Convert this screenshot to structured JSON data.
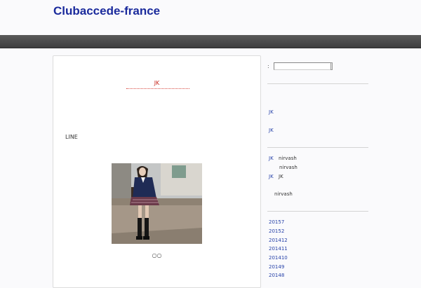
{
  "site": {
    "title": "Clubaccede-france"
  },
  "post": {
    "title": "JK",
    "text": "LINE",
    "caption": "○○",
    "image_alt": "Student in school uniform standing by a stone wall"
  },
  "search": {
    "label": ":"
  },
  "sidebar": {
    "recent_posts": [
      "JK",
      "JK"
    ],
    "comments": [
      {
        "link": "JK",
        "author": "nirvash"
      },
      {
        "link": "",
        "author": "nirvash"
      },
      {
        "link": "JK",
        "author": "JK"
      },
      {
        "link": "",
        "author": "nirvash"
      }
    ],
    "archives": [
      "20157",
      "20152",
      "201412",
      "201411",
      "201410",
      "20149",
      "20148"
    ]
  },
  "colors": {
    "title": "#1a2a9c",
    "navbar": "#4a4a4a",
    "link": "#2540a8",
    "post_title": "#c8281e"
  }
}
